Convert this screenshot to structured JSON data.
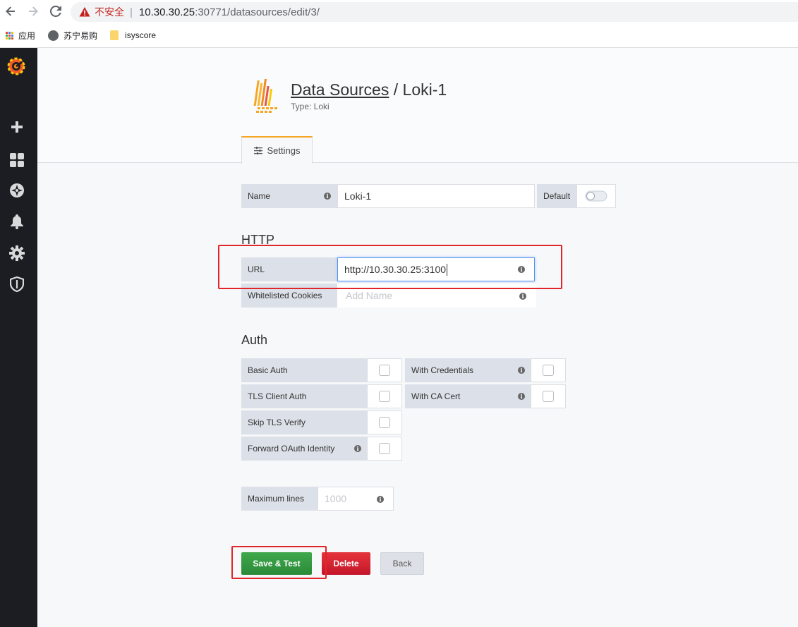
{
  "browser": {
    "insecure_label": "不安全",
    "url_host": "10.30.30.25",
    "url_rest": ":30771/datasources/edit/3/",
    "bookmarks": [
      {
        "label": "应用"
      },
      {
        "label": "苏宁易购"
      },
      {
        "label": "isyscore"
      }
    ]
  },
  "sidebar": {
    "items": [
      "grafana-logo",
      "plus-icon",
      "dashboards-icon",
      "explore-icon",
      "alerting-bell-icon",
      "configuration-gear-icon",
      "server-admin-shield-icon"
    ]
  },
  "header": {
    "breadcrumb_link": "Data Sources",
    "breadcrumb_sep": " / ",
    "breadcrumb_current": "Loki-1",
    "type_text": "Type: Loki",
    "tab_settings": "Settings"
  },
  "name_row": {
    "label": "Name",
    "value": "Loki-1",
    "default_label": "Default",
    "default_on": false
  },
  "http": {
    "heading": "HTTP",
    "url_label": "URL",
    "url_value": "http://10.30.30.25:3100",
    "cookies_label": "Whitelisted Cookies",
    "cookies_placeholder": "Add Name"
  },
  "auth": {
    "heading": "Auth",
    "basic_auth": "Basic Auth",
    "with_credentials": "With Credentials",
    "tls_client_auth": "TLS Client Auth",
    "with_ca_cert": "With CA Cert",
    "skip_tls_verify": "Skip TLS Verify",
    "forward_oauth": "Forward OAuth Identity"
  },
  "max_lines": {
    "label": "Maximum lines",
    "placeholder": "1000"
  },
  "buttons": {
    "save_test": "Save & Test",
    "delete": "Delete",
    "back": "Back"
  },
  "colors": {
    "sidebar_bg": "#1c1d22",
    "accent_orange": "#f5a623",
    "save_green": "#2b8a39",
    "delete_red": "#c4162a",
    "annotation_red": "#e2252b"
  }
}
